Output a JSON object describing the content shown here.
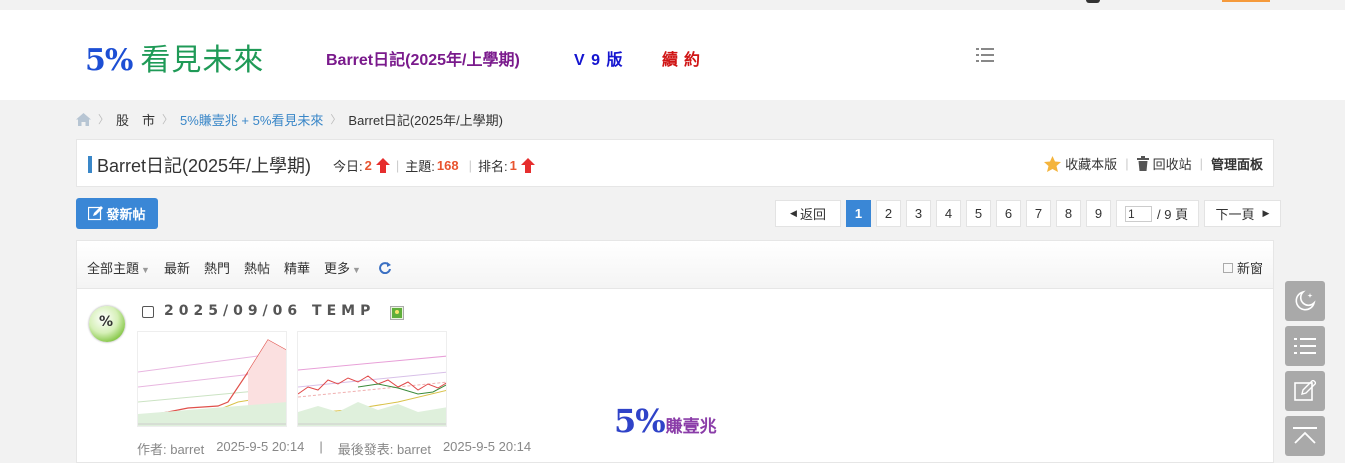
{
  "header": {
    "logo_number": "5%",
    "logo_text": "看見未來",
    "nav": [
      {
        "label": "Barret日記(2025年/上學期)",
        "color": "#7a1a8c"
      },
      {
        "label": "V 9 版",
        "color": "#1515d0"
      },
      {
        "label": "續約",
        "color": "#d01515"
      }
    ],
    "menu_icon": "list-menu-icon"
  },
  "breadcrumb": {
    "home_icon": "home-icon",
    "items": [
      "股　市",
      "5%賺壹兆 + 5%看見未來",
      "Barret日記(2025年/上學期)"
    ]
  },
  "forum": {
    "name": "Barret日記(2025年/上學期)",
    "today_label": "今日:",
    "today_value": "2",
    "topics_label": "主題:",
    "topics_value": "168",
    "rank_label": "排名:",
    "rank_value": "1",
    "favorite_label": "收藏本版",
    "recycle_label": "回收站",
    "admin_label": "管理面板"
  },
  "toolbar": {
    "new_post_label": "發新帖"
  },
  "pager": {
    "back_label": "返回",
    "pages": [
      "1",
      "2",
      "3",
      "4",
      "5",
      "6",
      "7",
      "8",
      "9"
    ],
    "current_page": "1",
    "jump_value": "1",
    "total_label": "/ 9 頁",
    "next_label": "下一頁"
  },
  "filters": {
    "all_label": "全部主題",
    "items": [
      "最新",
      "熱門",
      "熱帖",
      "精華"
    ],
    "more_label": "更多",
    "new_window_label": "新窗"
  },
  "thread": {
    "title": "2025/09/06 TEMP",
    "watermark_number": "5%",
    "watermark_text": "賺壹兆",
    "author_label": "作者: barret",
    "post_time": "2025-9-5 20:14",
    "separator": "|",
    "last_post_label": "最後發表: barret",
    "last_post_time": "2025-9-5 20:14"
  },
  "side_tools": [
    "moon-icon",
    "list-icon",
    "edit-icon",
    "back-to-top-icon"
  ],
  "colors": {
    "accent_blue": "#3a87d6",
    "stat_red": "#e8542f",
    "link_blue": "#3a87c8"
  }
}
